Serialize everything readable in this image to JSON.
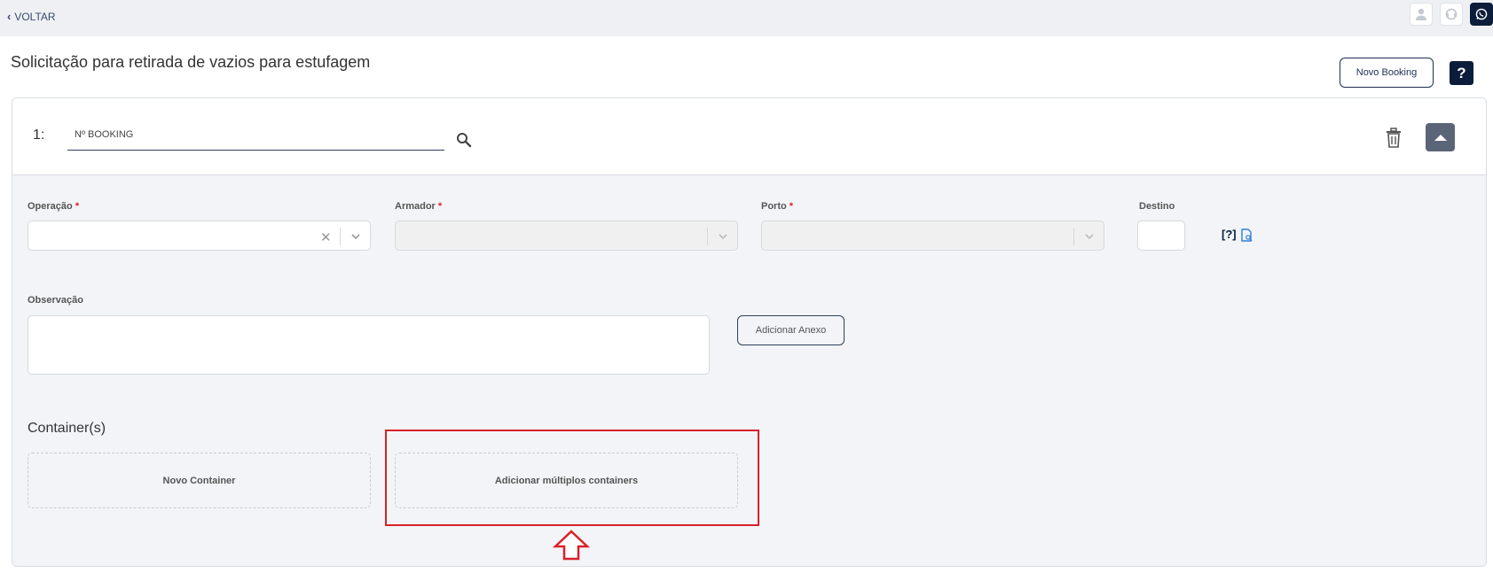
{
  "topbar": {
    "back_label": "VOLTAR",
    "icons": [
      "user-icon",
      "support-icon",
      "whatsapp-icon"
    ]
  },
  "page": {
    "title": "Solicitação para retirada de vazios para estufagem",
    "new_booking_label": "Novo Booking",
    "help_label": "?"
  },
  "booking": {
    "index": "1:",
    "input_placeholder": "Nº BOOKING"
  },
  "fields": {
    "operacao_label": "Operação",
    "armador_label": "Armador",
    "porto_label": "Porto",
    "destino_label": "Destino",
    "required_mark": "*",
    "destino_help": "[?]",
    "observacao_label": "Observação",
    "anexo_label": "Adicionar Anexo"
  },
  "containers": {
    "section_title": "Container(s)",
    "new_container_label": "Novo Container",
    "multi_container_label": "Adicionar múltiplos containers"
  },
  "colors": {
    "accent": "#0b1d3a",
    "highlight": "#d9202a",
    "panel_bg": "#f2f4f7"
  }
}
